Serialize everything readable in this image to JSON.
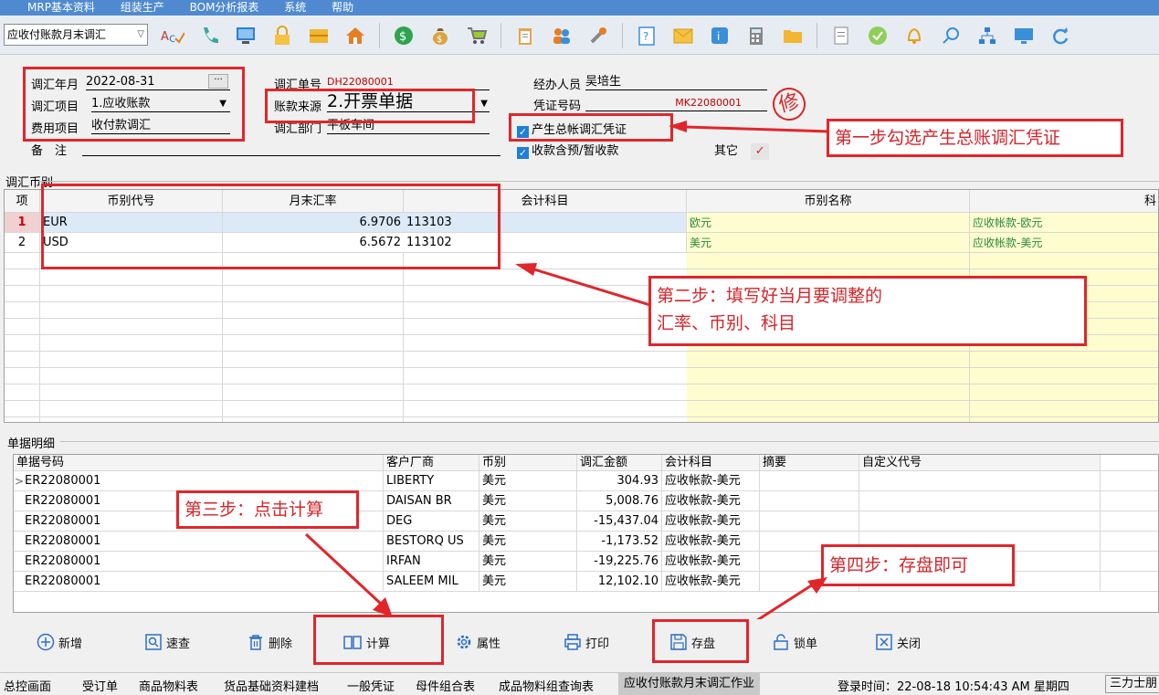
{
  "menu": [
    "MRP基本资料",
    "组装生产",
    "BOM分析报表",
    "系统",
    "帮助"
  ],
  "toolbar": {
    "module_select": "应收付账款月末调汇"
  },
  "form": {
    "month_label": "调汇年月",
    "month_value": "2022-08-31",
    "item_label": "调汇项目",
    "item_value": "1.应收账款",
    "fee_label": "费用项目",
    "fee_value": "收付款调汇",
    "remark_label": "备　注",
    "doc_no_label": "调汇单号",
    "doc_no_value": "DH22080001",
    "source_label": "账款来源",
    "source_value": "2.开票单据",
    "dept_label": "调汇部门",
    "dept_value": "平板车间",
    "handler_label": "经办人员",
    "handler_value": "吴培生",
    "voucher_label": "凭证号码",
    "voucher_value": "MK22080001",
    "gen_voucher_label": "产生总帐调汇凭证",
    "include_prepay_label": "收款含预/暂收款",
    "other_label": "其它",
    "stamp_text": "修"
  },
  "section1": {
    "title": "调汇币别"
  },
  "grid1": {
    "headers": [
      "项",
      "币别代号",
      "月末汇率",
      "会计科目",
      "币别名称",
      "科"
    ],
    "rows": [
      {
        "idx": "1",
        "code": "EUR",
        "rate": "6.9706",
        "account": "113103",
        "name": "欧元",
        "subject": "应收帐款-欧元"
      },
      {
        "idx": "2",
        "code": "USD",
        "rate": "6.5672",
        "account": "113102",
        "name": "美元",
        "subject": "应收帐款-美元"
      }
    ]
  },
  "section2": {
    "title": "单据明细"
  },
  "grid2": {
    "headers": [
      "单据号码",
      "客户厂商",
      "币别",
      "调汇金额",
      "会计科目",
      "摘要",
      "自定义代号"
    ],
    "rows": [
      {
        "no": "ER22080001",
        "customer": "LIBERTY",
        "currency": "美元",
        "amount": "304.93",
        "account": "应收帐款-美元"
      },
      {
        "no": "ER22080001",
        "customer": "DAISAN BR",
        "currency": "美元",
        "amount": "5,008.76",
        "account": "应收帐款-美元"
      },
      {
        "no": "ER22080001",
        "customer": "DEG",
        "currency": "美元",
        "amount": "-15,437.04",
        "account": "应收帐款-美元"
      },
      {
        "no": "ER22080001",
        "customer": "BESTORQ US",
        "currency": "美元",
        "amount": "-1,173.52",
        "account": "应收帐款-美元"
      },
      {
        "no": "ER22080001",
        "customer": "IRFAN",
        "currency": "美元",
        "amount": "-19,225.76",
        "account": "应收帐款-美元"
      },
      {
        "no": "ER22080001",
        "customer": "SALEEM MIL",
        "currency": "美元",
        "amount": "12,102.10",
        "account": "应收帐款-美元"
      }
    ]
  },
  "buttons": {
    "add": "新增",
    "search": "速查",
    "delete": "删除",
    "calc": "计算",
    "props": "属性",
    "print": "打印",
    "save": "存盘",
    "lock": "锁单",
    "close": "关闭"
  },
  "callouts": {
    "step1": "第一步勾选产生总账调汇凭证",
    "step2_line1": "第二步：填写好当月要调整的",
    "step2_line2": "汇率、币别、科目",
    "step3": "第三步：点击计算",
    "step4": "第四步：存盘即可"
  },
  "statusbar": {
    "tabs": [
      "总控画面",
      "受订单",
      "商品物料表",
      "货品基础资料建档",
      "一般凭证",
      "母件组合表",
      "成品物料组查询表",
      "应收付账款月末调汇作业"
    ],
    "login": "登录时间：22-08-18 10:54:43 AM 星期四",
    "company": "三力士朋"
  },
  "colors": {
    "annotation": "#e0262b",
    "menubar": "#4f8ad0",
    "highlight_col": "#fffdd0",
    "selected_row": "#dce9f7"
  }
}
